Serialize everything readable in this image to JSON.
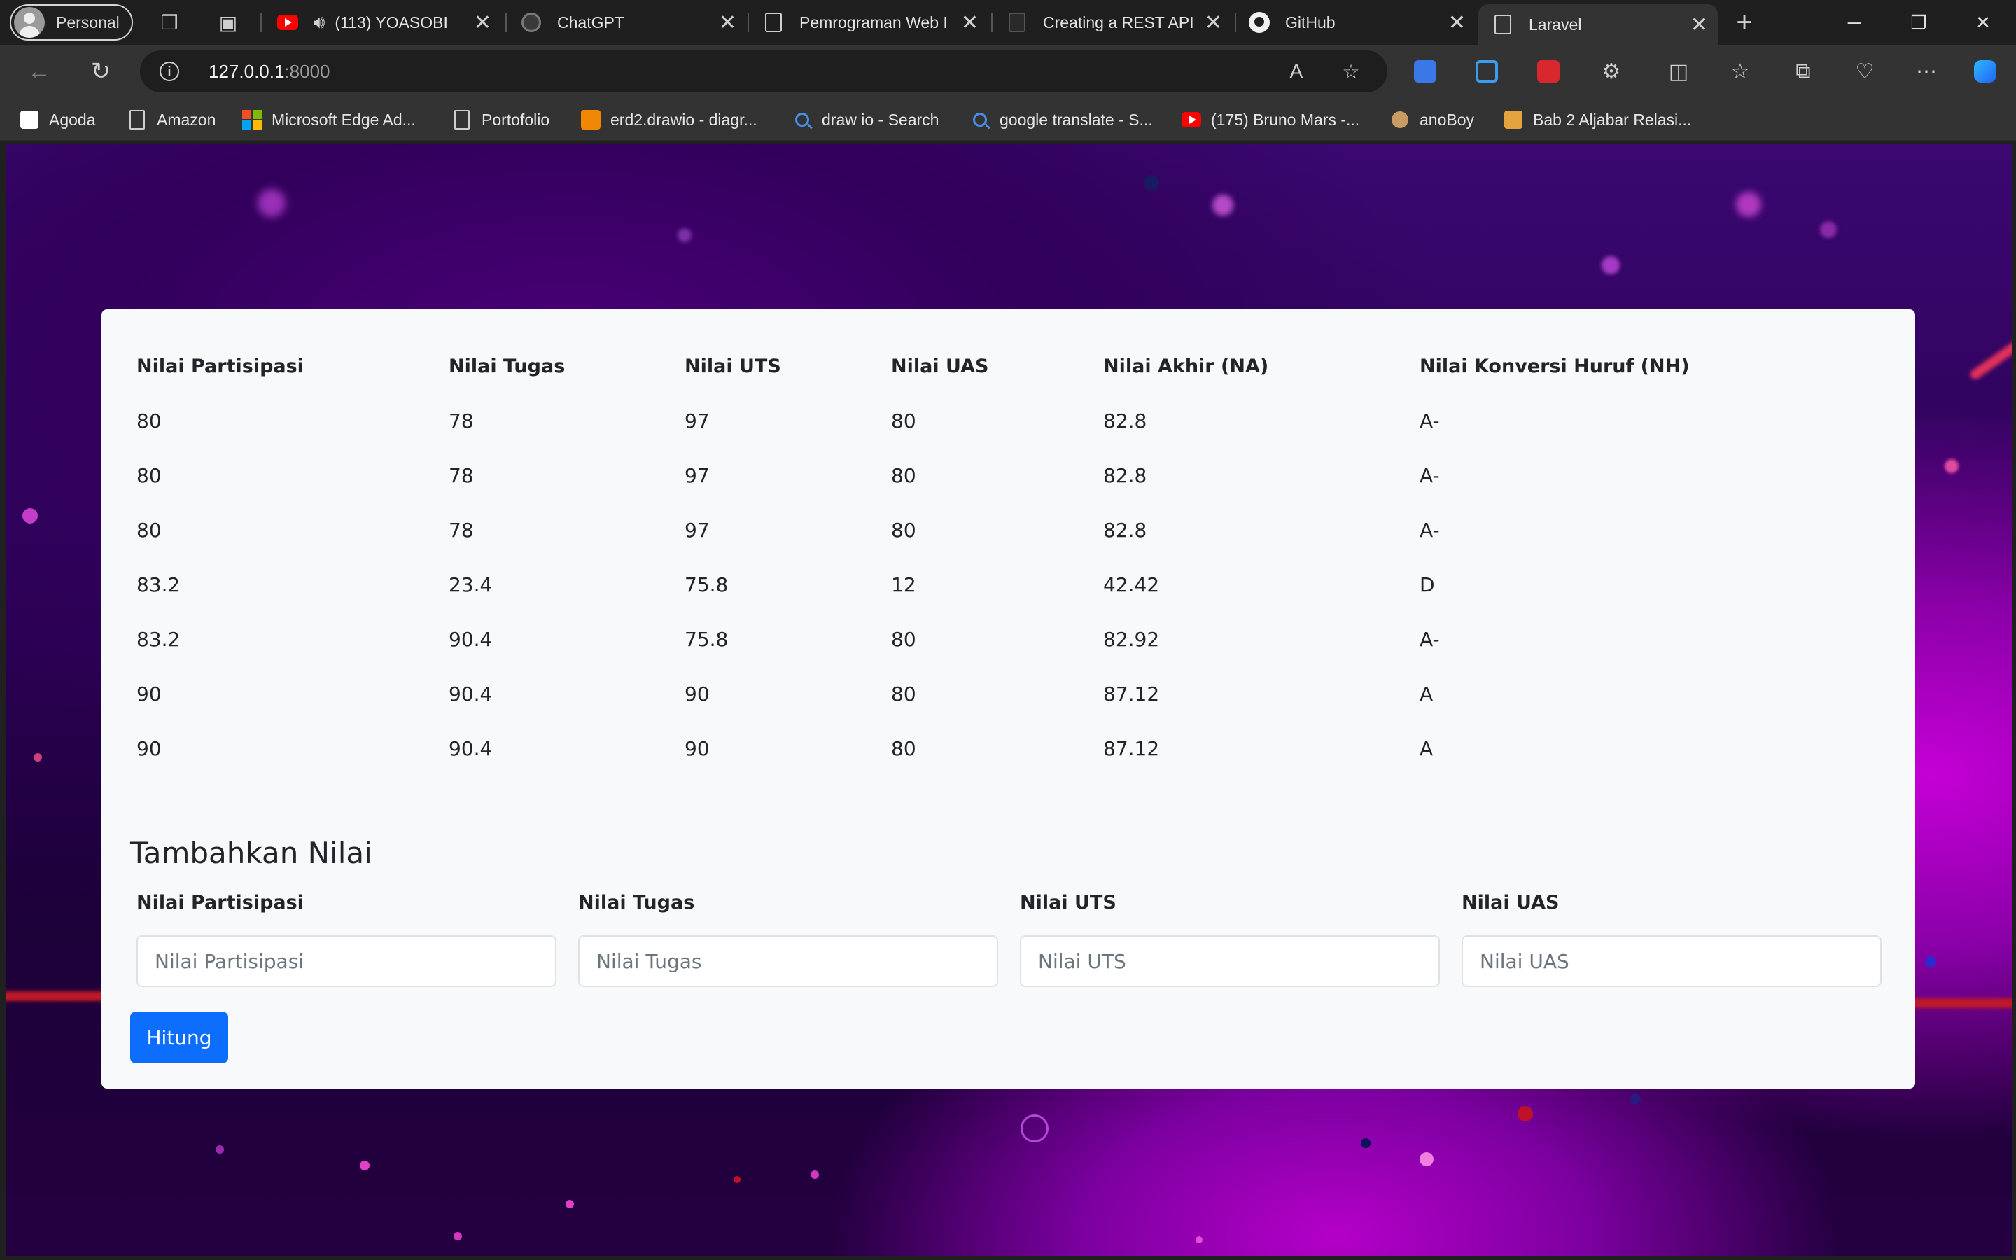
{
  "browser": {
    "profile_label": "Personal",
    "tabs": [
      {
        "title": "(113) YOASOBI",
        "icon": "youtube-icon"
      },
      {
        "title": "ChatGPT",
        "icon": "chatgpt-icon"
      },
      {
        "title": "Pemrograman Web I",
        "icon": "page-icon"
      },
      {
        "title": "Creating a REST API",
        "icon": "page-icon"
      },
      {
        "title": "GitHub",
        "icon": "github-icon"
      },
      {
        "title": "Laravel",
        "icon": "document-icon"
      }
    ],
    "url_host": "127.0.0.1",
    "url_port": ":8000",
    "bookmarks": [
      {
        "label": "Agoda"
      },
      {
        "label": "Amazon"
      },
      {
        "label": "Microsoft Edge Ad..."
      },
      {
        "label": "Portofolio"
      },
      {
        "label": "erd2.drawio - diagr..."
      },
      {
        "label": "draw io - Search"
      },
      {
        "label": "google translate - S..."
      },
      {
        "label": "(175) Bruno Mars -..."
      },
      {
        "label": "anoBoy"
      },
      {
        "label": "Bab 2 Aljabar Relasi..."
      }
    ]
  },
  "table": {
    "headers": [
      "Nilai Partisipasi",
      "Nilai Tugas",
      "Nilai UTS",
      "Nilai UAS",
      "Nilai Akhir (NA)",
      "Nilai Konversi Huruf (NH)"
    ],
    "rows": [
      [
        "80",
        "78",
        "97",
        "80",
        "82.8",
        "A-"
      ],
      [
        "80",
        "78",
        "97",
        "80",
        "82.8",
        "A-"
      ],
      [
        "80",
        "78",
        "97",
        "80",
        "82.8",
        "A-"
      ],
      [
        "83.2",
        "23.4",
        "75.8",
        "12",
        "42.42",
        "D"
      ],
      [
        "83.2",
        "90.4",
        "75.8",
        "80",
        "82.92",
        "A-"
      ],
      [
        "90",
        "90.4",
        "90",
        "80",
        "87.12",
        "A"
      ],
      [
        "90",
        "90.4",
        "90",
        "80",
        "87.12",
        "A"
      ]
    ]
  },
  "form": {
    "title": "Tambahkan Nilai",
    "fields": [
      {
        "label": "Nilai Partisipasi",
        "placeholder": "Nilai Partisipasi",
        "value": ""
      },
      {
        "label": "Nilai Tugas",
        "placeholder": "Nilai Tugas",
        "value": ""
      },
      {
        "label": "Nilai UTS",
        "placeholder": "Nilai UTS",
        "value": ""
      },
      {
        "label": "Nilai UAS",
        "placeholder": "Nilai UAS",
        "value": ""
      }
    ],
    "submit_label": "Hitung"
  },
  "colors": {
    "primary": "#0d6efd",
    "card_bg": "#f8f9fa",
    "browser_bg": "#1f1f1f",
    "toolbar_bg": "#333333"
  }
}
